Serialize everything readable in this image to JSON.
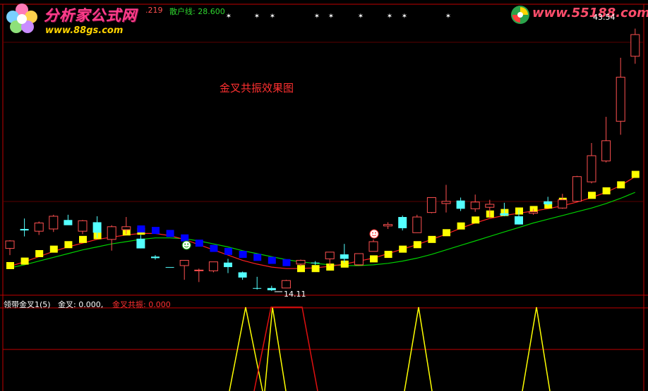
{
  "topbar": {
    "value_text": ".219",
    "sanhu_text": "散户线: 28.600"
  },
  "logos": {
    "left_title": "分析家公式网",
    "left_url": "www.88gs.com",
    "right_url": "www.55188.com"
  },
  "annotations": {
    "main_caption": "金叉共振效果图",
    "high_value": "43.54",
    "low_value": "14.11"
  },
  "indicator": {
    "name": "领带金叉1(5)",
    "line1_label": "金叉: 0.000,",
    "line2_label": "金叉共振: 0.000"
  },
  "colors": {
    "background": "#000000",
    "frame": "#c00000",
    "up_candle": "#ff5050",
    "down_candle": "#54ffff",
    "yellow_signal": "#ffff00",
    "blue_signal": "#0000ff",
    "red_line": "#ff2020",
    "green_line": "#00d000",
    "caption": "#ff3030"
  },
  "icons": [
    "flower-logo-icon",
    "swirl-logo-icon",
    "smiley-icon",
    "smiley-face-icon",
    "star-marker-icon"
  ],
  "chart_data": [
    {
      "type": "candlestick",
      "title": "金叉共振效果图",
      "ylim": [
        10,
        46
      ],
      "candles": [
        {
          "o": 15.6,
          "h": 16.7,
          "l": 14.7,
          "c": 16.6,
          "dir": "up"
        },
        {
          "o": 18.2,
          "h": 19.6,
          "l": 17.2,
          "c": 18.0,
          "dir": "down"
        },
        {
          "o": 17.9,
          "h": 19.2,
          "l": 17.4,
          "c": 19.0,
          "dir": "up"
        },
        {
          "o": 18.2,
          "h": 20.1,
          "l": 17.8,
          "c": 19.9,
          "dir": "up"
        },
        {
          "o": 19.4,
          "h": 20.1,
          "l": 18.8,
          "c": 18.7,
          "dir": "down"
        },
        {
          "o": 17.9,
          "h": 19.4,
          "l": 17.5,
          "c": 19.3,
          "dir": "up"
        },
        {
          "o": 19.1,
          "h": 19.9,
          "l": 17.0,
          "c": 17.7,
          "dir": "down"
        },
        {
          "o": 16.8,
          "h": 18.7,
          "l": 15.3,
          "c": 18.5,
          "dir": "up"
        },
        {
          "o": 18.1,
          "h": 19.8,
          "l": 17.5,
          "c": 18.5,
          "dir": "up"
        },
        {
          "o": 16.9,
          "h": 17.4,
          "l": 15.6,
          "c": 15.6,
          "dir": "down"
        },
        {
          "o": 14.5,
          "h": 14.7,
          "l": 14.1,
          "c": 14.3,
          "dir": "down"
        },
        {
          "o": 13.1,
          "h": 13.1,
          "l": 13.1,
          "c": 13.1,
          "dir": "down"
        },
        {
          "o": 13.3,
          "h": 14.0,
          "l": 11.4,
          "c": 14.0,
          "dir": "up"
        },
        {
          "o": 12.7,
          "h": 12.9,
          "l": 11.1,
          "c": 12.7,
          "dir": "up"
        },
        {
          "o": 12.6,
          "h": 13.8,
          "l": 12.4,
          "c": 13.8,
          "dir": "up"
        },
        {
          "o": 13.7,
          "h": 14.2,
          "l": 12.3,
          "c": 13.1,
          "dir": "down"
        },
        {
          "o": 12.4,
          "h": 12.5,
          "l": 11.4,
          "c": 11.7,
          "dir": "down"
        },
        {
          "o": 10.3,
          "h": 11.8,
          "l": 10.1,
          "c": 10.3,
          "dir": "down"
        },
        {
          "o": 10.3,
          "h": 10.6,
          "l": 9.9,
          "c": 10.0,
          "dir": "down"
        },
        {
          "o": 10.3,
          "h": 11.4,
          "l": 10.3,
          "c": 11.3,
          "dir": "up"
        },
        {
          "o": 13.5,
          "h": 14.1,
          "l": 13.2,
          "c": 14.0,
          "dir": "up"
        },
        {
          "o": 13.7,
          "h": 13.9,
          "l": 13.4,
          "c": 13.7,
          "dir": "down"
        },
        {
          "o": 14.2,
          "h": 15.1,
          "l": 13.3,
          "c": 15.1,
          "dir": "up"
        },
        {
          "o": 14.8,
          "h": 16.2,
          "l": 13.7,
          "c": 14.2,
          "dir": "down"
        },
        {
          "o": 13.4,
          "h": 14.9,
          "l": 13.3,
          "c": 14.9,
          "dir": "up"
        },
        {
          "o": 15.2,
          "h": 16.8,
          "l": 15.2,
          "c": 16.5,
          "dir": "up"
        },
        {
          "o": 18.6,
          "h": 19.1,
          "l": 18.2,
          "c": 18.8,
          "dir": "up"
        },
        {
          "o": 19.8,
          "h": 20.0,
          "l": 18.0,
          "c": 18.3,
          "dir": "down"
        },
        {
          "o": 17.7,
          "h": 20.1,
          "l": 17.7,
          "c": 19.8,
          "dir": "up"
        },
        {
          "o": 20.4,
          "h": 22.4,
          "l": 20.3,
          "c": 22.4,
          "dir": "up"
        },
        {
          "o": 21.6,
          "h": 24.1,
          "l": 20.4,
          "c": 21.9,
          "dir": "up"
        },
        {
          "o": 22.0,
          "h": 22.4,
          "l": 20.6,
          "c": 20.9,
          "dir": "down"
        },
        {
          "o": 20.9,
          "h": 22.8,
          "l": 20.5,
          "c": 21.8,
          "dir": "up"
        },
        {
          "o": 21.5,
          "h": 22.1,
          "l": 19.8,
          "c": 21.1,
          "dir": "up"
        },
        {
          "o": 20.3,
          "h": 21.7,
          "l": 19.9,
          "c": 20.0,
          "dir": "down"
        },
        {
          "o": 19.9,
          "h": 20.8,
          "l": 18.8,
          "c": 18.8,
          "dir": "down"
        },
        {
          "o": 20.3,
          "h": 20.9,
          "l": 20.1,
          "c": 20.5,
          "dir": "up"
        },
        {
          "o": 21.9,
          "h": 22.5,
          "l": 21.3,
          "c": 21.5,
          "dir": "down"
        },
        {
          "o": 21.0,
          "h": 22.9,
          "l": 20.9,
          "c": 22.1,
          "dir": "up"
        },
        {
          "o": 21.9,
          "h": 25.3,
          "l": 21.8,
          "c": 25.2,
          "dir": "up"
        },
        {
          "o": 24.5,
          "h": 29.7,
          "l": 24.3,
          "c": 28.0,
          "dir": "up"
        },
        {
          "o": 27.3,
          "h": 33.2,
          "l": 27.1,
          "c": 30.0,
          "dir": "up"
        },
        {
          "o": 32.6,
          "h": 41.1,
          "l": 30.8,
          "c": 38.5,
          "dir": "up"
        },
        {
          "o": 41.3,
          "h": 45.0,
          "l": 40.3,
          "c": 44.2,
          "dir": "up"
        }
      ],
      "yellow_signal": [
        13.3,
        13.9,
        14.9,
        15.5,
        16.1,
        16.8,
        17.3,
        17.5,
        17.8,
        17.9,
        null,
        null,
        null,
        null,
        null,
        null,
        null,
        null,
        null,
        null,
        12.9,
        12.9,
        13.1,
        13.5,
        13.8,
        14.2,
        14.8,
        15.5,
        16.1,
        16.8,
        17.7,
        18.6,
        19.4,
        20.2,
        20.4,
        20.6,
        20.8,
        21.4,
        21.9,
        22.4,
        22.7,
        23.3,
        24.1,
        25.5
      ],
      "blue_signal": [
        null,
        null,
        null,
        null,
        null,
        null,
        null,
        null,
        null,
        18.2,
        18.0,
        17.6,
        17.0,
        16.3,
        15.6,
        15.2,
        14.8,
        14.4,
        14.0,
        13.7,
        null,
        null,
        null,
        null,
        null,
        null,
        null,
        null,
        null,
        null,
        null,
        null,
        null,
        null,
        null,
        null,
        null,
        null,
        null,
        null,
        null,
        null,
        null,
        null
      ],
      "red_line": [
        13.2,
        13.8,
        14.5,
        15.2,
        15.8,
        16.3,
        16.8,
        17.1,
        17.4,
        17.6,
        17.6,
        17.3,
        16.8,
        16.1,
        15.4,
        14.7,
        14.0,
        13.5,
        13.1,
        12.9,
        12.9,
        13.0,
        13.2,
        13.5,
        13.9,
        14.3,
        14.9,
        15.5,
        16.1,
        16.8,
        17.5,
        18.3,
        19.0,
        19.6,
        20.0,
        20.3,
        20.6,
        20.9,
        21.3,
        21.8,
        22.4,
        23.1,
        24.0,
        25.2
      ],
      "green_line": [
        13.0,
        13.4,
        13.9,
        14.4,
        14.9,
        15.4,
        15.8,
        16.2,
        16.5,
        16.8,
        17.0,
        17.0,
        16.9,
        16.6,
        16.2,
        15.8,
        15.3,
        14.9,
        14.5,
        14.1,
        13.8,
        13.6,
        13.4,
        13.3,
        13.3,
        13.4,
        13.6,
        13.9,
        14.3,
        14.8,
        15.4,
        16.0,
        16.6,
        17.2,
        17.8,
        18.4,
        19.0,
        19.5,
        20.0,
        20.5,
        21.0,
        21.6,
        22.3,
        23.1
      ]
    },
    {
      "type": "line",
      "title": "领带金叉1(5)",
      "series": [
        {
          "name": "金叉",
          "values": [
            0,
            0,
            0,
            0,
            0,
            0,
            0,
            0,
            0,
            0,
            0,
            0,
            0,
            0,
            0,
            0,
            0,
            0,
            0,
            0,
            0,
            0,
            0,
            0,
            0,
            0,
            0,
            0,
            0,
            0,
            0,
            0,
            0,
            0,
            0,
            0,
            0,
            0,
            0,
            0,
            0,
            0,
            0,
            0
          ]
        },
        {
          "name": "金叉共振",
          "values": [
            0,
            0,
            0,
            0,
            0,
            0,
            0,
            0,
            0,
            0,
            0,
            0,
            0,
            0,
            0,
            0,
            0,
            0,
            0,
            0,
            0,
            0,
            0,
            0,
            0,
            0,
            0,
            0,
            0,
            0,
            0,
            0,
            0,
            0,
            0,
            0,
            0,
            0,
            0,
            0,
            0,
            0,
            0,
            0
          ]
        }
      ]
    }
  ]
}
